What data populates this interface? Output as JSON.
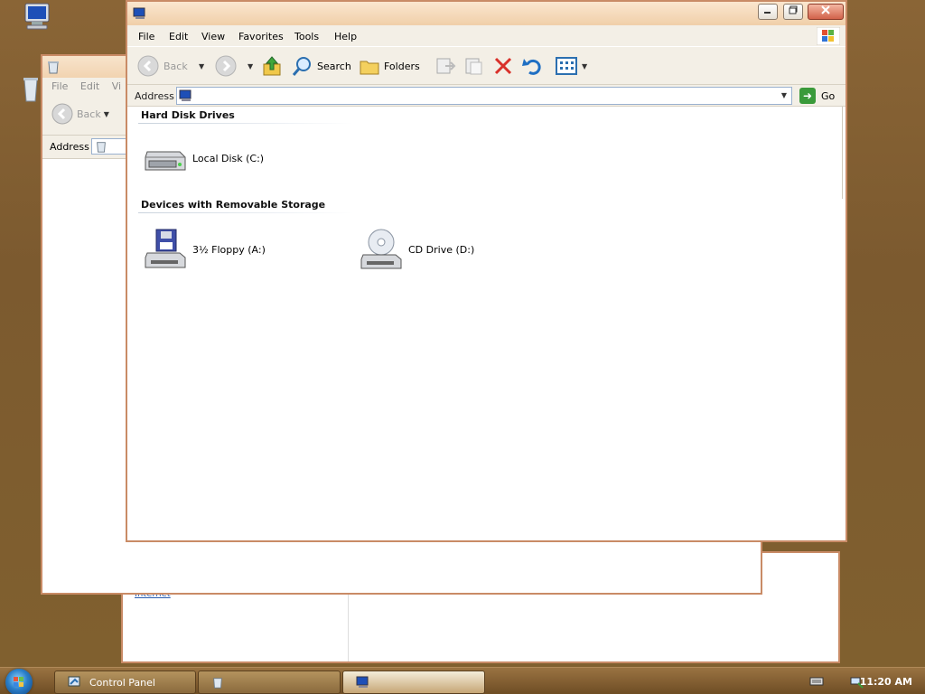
{
  "desktop": {
    "icons": [
      "my-computer-icon",
      "recycle-bin-icon"
    ]
  },
  "back_window_2": {
    "link_text": "Internet"
  },
  "back_window_1": {
    "menu": [
      "File",
      "Edit",
      "Vi"
    ],
    "back_label": "Back",
    "address_label": "Address"
  },
  "main_window": {
    "title": "",
    "menu": {
      "file": "File",
      "edit": "Edit",
      "view": "View",
      "favorites": "Favorites",
      "tools": "Tools",
      "help": "Help"
    },
    "toolbar": {
      "back": "Back",
      "search": "Search",
      "folders": "Folders"
    },
    "address": {
      "label": "Address",
      "value": "",
      "go": "Go"
    },
    "groups": {
      "hard_disks": "Hard Disk Drives",
      "removable": "Devices with Removable Storage"
    },
    "drives": {
      "local_disk": "Local Disk (C:)",
      "floppy": "3½ Floppy (A:)",
      "cd_drive": "CD Drive (D:)"
    }
  },
  "taskbar": {
    "buttons": [
      {
        "label": "Control Panel",
        "icon": "control-panel-icon",
        "active": false
      },
      {
        "label": "",
        "icon": "recycle-bin-icon",
        "active": false
      },
      {
        "label": "",
        "icon": "my-computer-icon",
        "active": true
      }
    ],
    "clock": "11:20 AM"
  },
  "colors": {
    "desktop": "#7c5a2f",
    "window_border": "#c98b66",
    "toolbar_bg": "#f3efe6",
    "taskbar": "#7a5a2e"
  }
}
